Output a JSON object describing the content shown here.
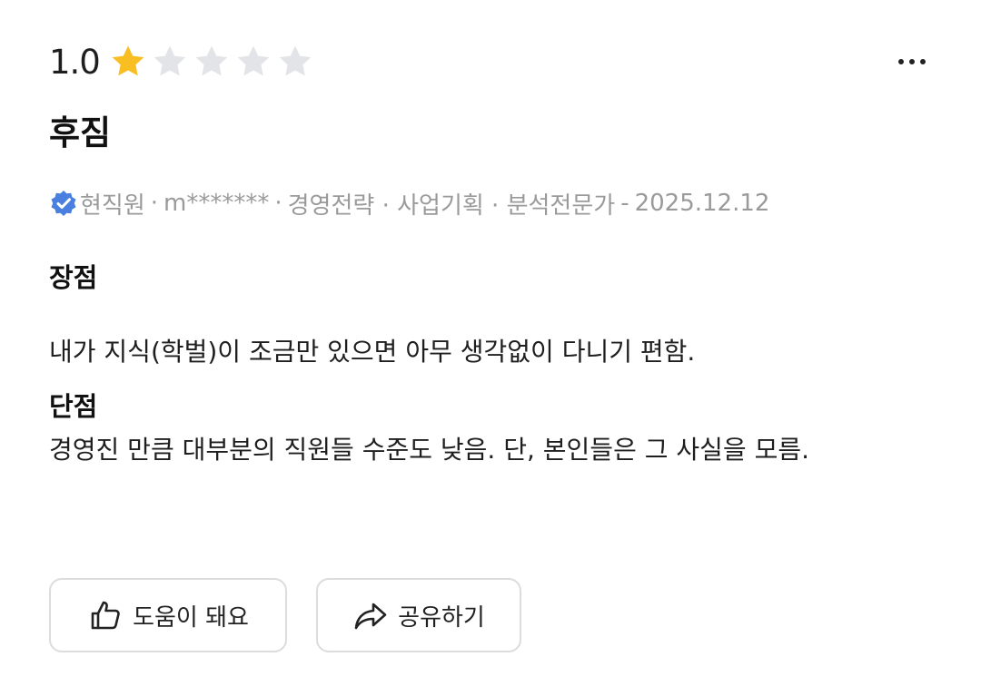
{
  "rating": {
    "value": "1.0",
    "score": 1,
    "max": 5,
    "filled_color": "#F9BE22",
    "empty_color": "#E3E4E8"
  },
  "menu": {
    "icon": "more-horizontal-icon"
  },
  "review": {
    "title": "후짐",
    "author": {
      "verified_icon": "verified-badge-icon",
      "verified_color": "#4A7FE0",
      "status": "현직원",
      "user": "m*******",
      "job": "경영전략 · 사업기획 · 분석전문가",
      "date": "2025.12.12"
    },
    "pros_label": "장점",
    "pros_text": "내가 지식(학벌)이 조금만 있으면 아무 생각없이 다니기 편함.",
    "cons_label": "단점",
    "cons_text": "경영진 만큼 대부분의 직원들 수준도 낮음. 단, 본인들은 그 사실을 모름."
  },
  "actions": {
    "helpful_label": "도움이 돼요",
    "helpful_icon": "thumbs-up-icon",
    "share_label": "공유하기",
    "share_icon": "share-arrow-icon"
  }
}
